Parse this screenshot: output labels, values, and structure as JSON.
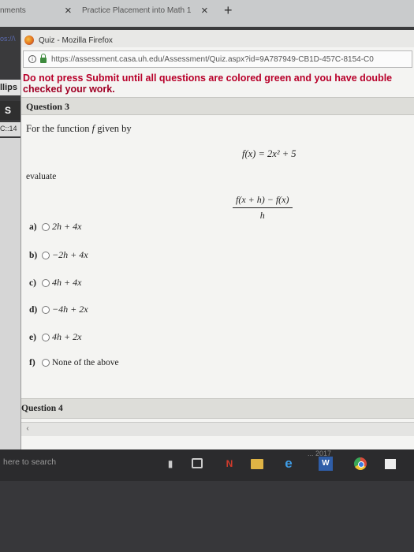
{
  "browser": {
    "tabs": [
      {
        "label": "nments"
      },
      {
        "label": "Practice Placement into Math 1"
      }
    ],
    "tab_close_glyph": "×",
    "new_tab_glyph": "+"
  },
  "edge": {
    "url_fragment": "os://\\",
    "lips": "llips",
    "s_label": "S",
    "time": "C::14"
  },
  "popup": {
    "window_title": "Quiz - Mozilla Firefox",
    "url": "https://assessment.casa.uh.edu/Assessment/Quiz.aspx?id=9A787949-CB1D-457C-8154-C0",
    "warning_line1": "Do not press Submit until all questions are colored green and you have double",
    "warning_line2": "checked your work."
  },
  "question3": {
    "header": "Question 3",
    "prompt_prefix": "For the function",
    "prompt_var": "f",
    "prompt_suffix": "given by",
    "function_def": "f(x) = 2x² + 5",
    "evaluate_label": "evaluate",
    "numerator": "f(x + h) − f(x)",
    "denominator": "h",
    "options": [
      {
        "letter": "a)",
        "expr": "2h + 4x"
      },
      {
        "letter": "b)",
        "expr": "−2h + 4x"
      },
      {
        "letter": "c)",
        "expr": "4h + 4x"
      },
      {
        "letter": "d)",
        "expr": "−4h + 2x"
      },
      {
        "letter": "e)",
        "expr": "4h + 2x"
      },
      {
        "letter": "f)",
        "expr": "None of the above"
      }
    ]
  },
  "question4": {
    "header": "Question 4"
  },
  "taskbar": {
    "search_placeholder": "here to search",
    "tray_date": "... 2017",
    "icons": [
      "microphone-icon",
      "task-view-icon",
      "onenote-icon",
      "file-explorer-icon",
      "edge-browser-icon",
      "word-icon",
      "chrome-icon",
      "store-icon"
    ]
  }
}
